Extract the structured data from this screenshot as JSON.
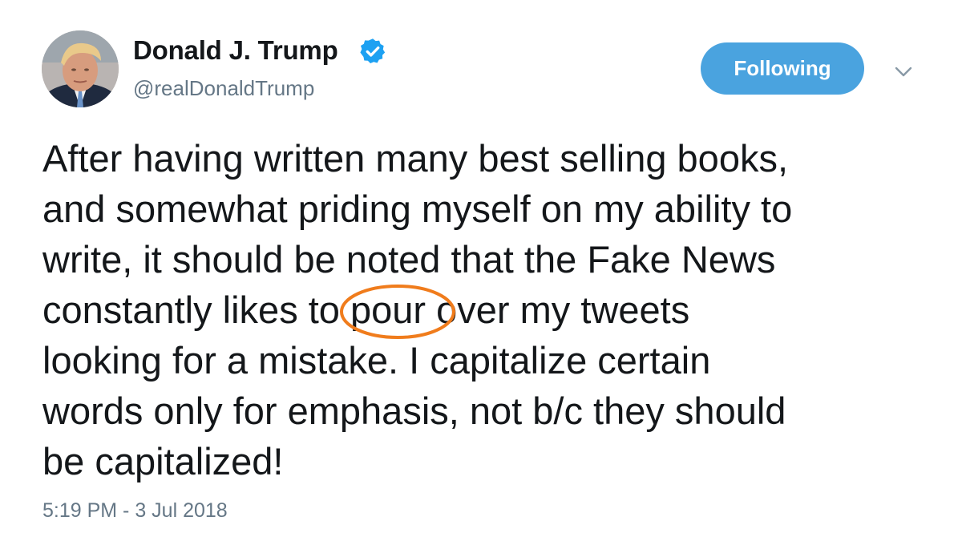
{
  "author": {
    "name": "Donald J. Trump",
    "handle": "@realDonaldTrump",
    "verified": true,
    "avatar_icon": "profile-photo-avatar"
  },
  "actions": {
    "follow_label": "Following",
    "menu_icon": "chevron-down-icon"
  },
  "tweet": {
    "lines": [
      "After having written many best selling books,",
      "and somewhat priding myself on my ability to",
      "write, it should be noted that the Fake News",
      "constantly likes to",
      "pour",
      "over my tweets",
      "looking for a mistake. I capitalize certain",
      "words only for emphasis, not b/c they should",
      "be capitalized!"
    ],
    "timestamp": "5:19 PM - 3 Jul 2018"
  },
  "colors": {
    "follow_button": "#4aa3df",
    "verified": "#1da1f2",
    "annotation_circle": "#f07c1c",
    "secondary_text": "#657786",
    "primary_text": "#14171a"
  }
}
